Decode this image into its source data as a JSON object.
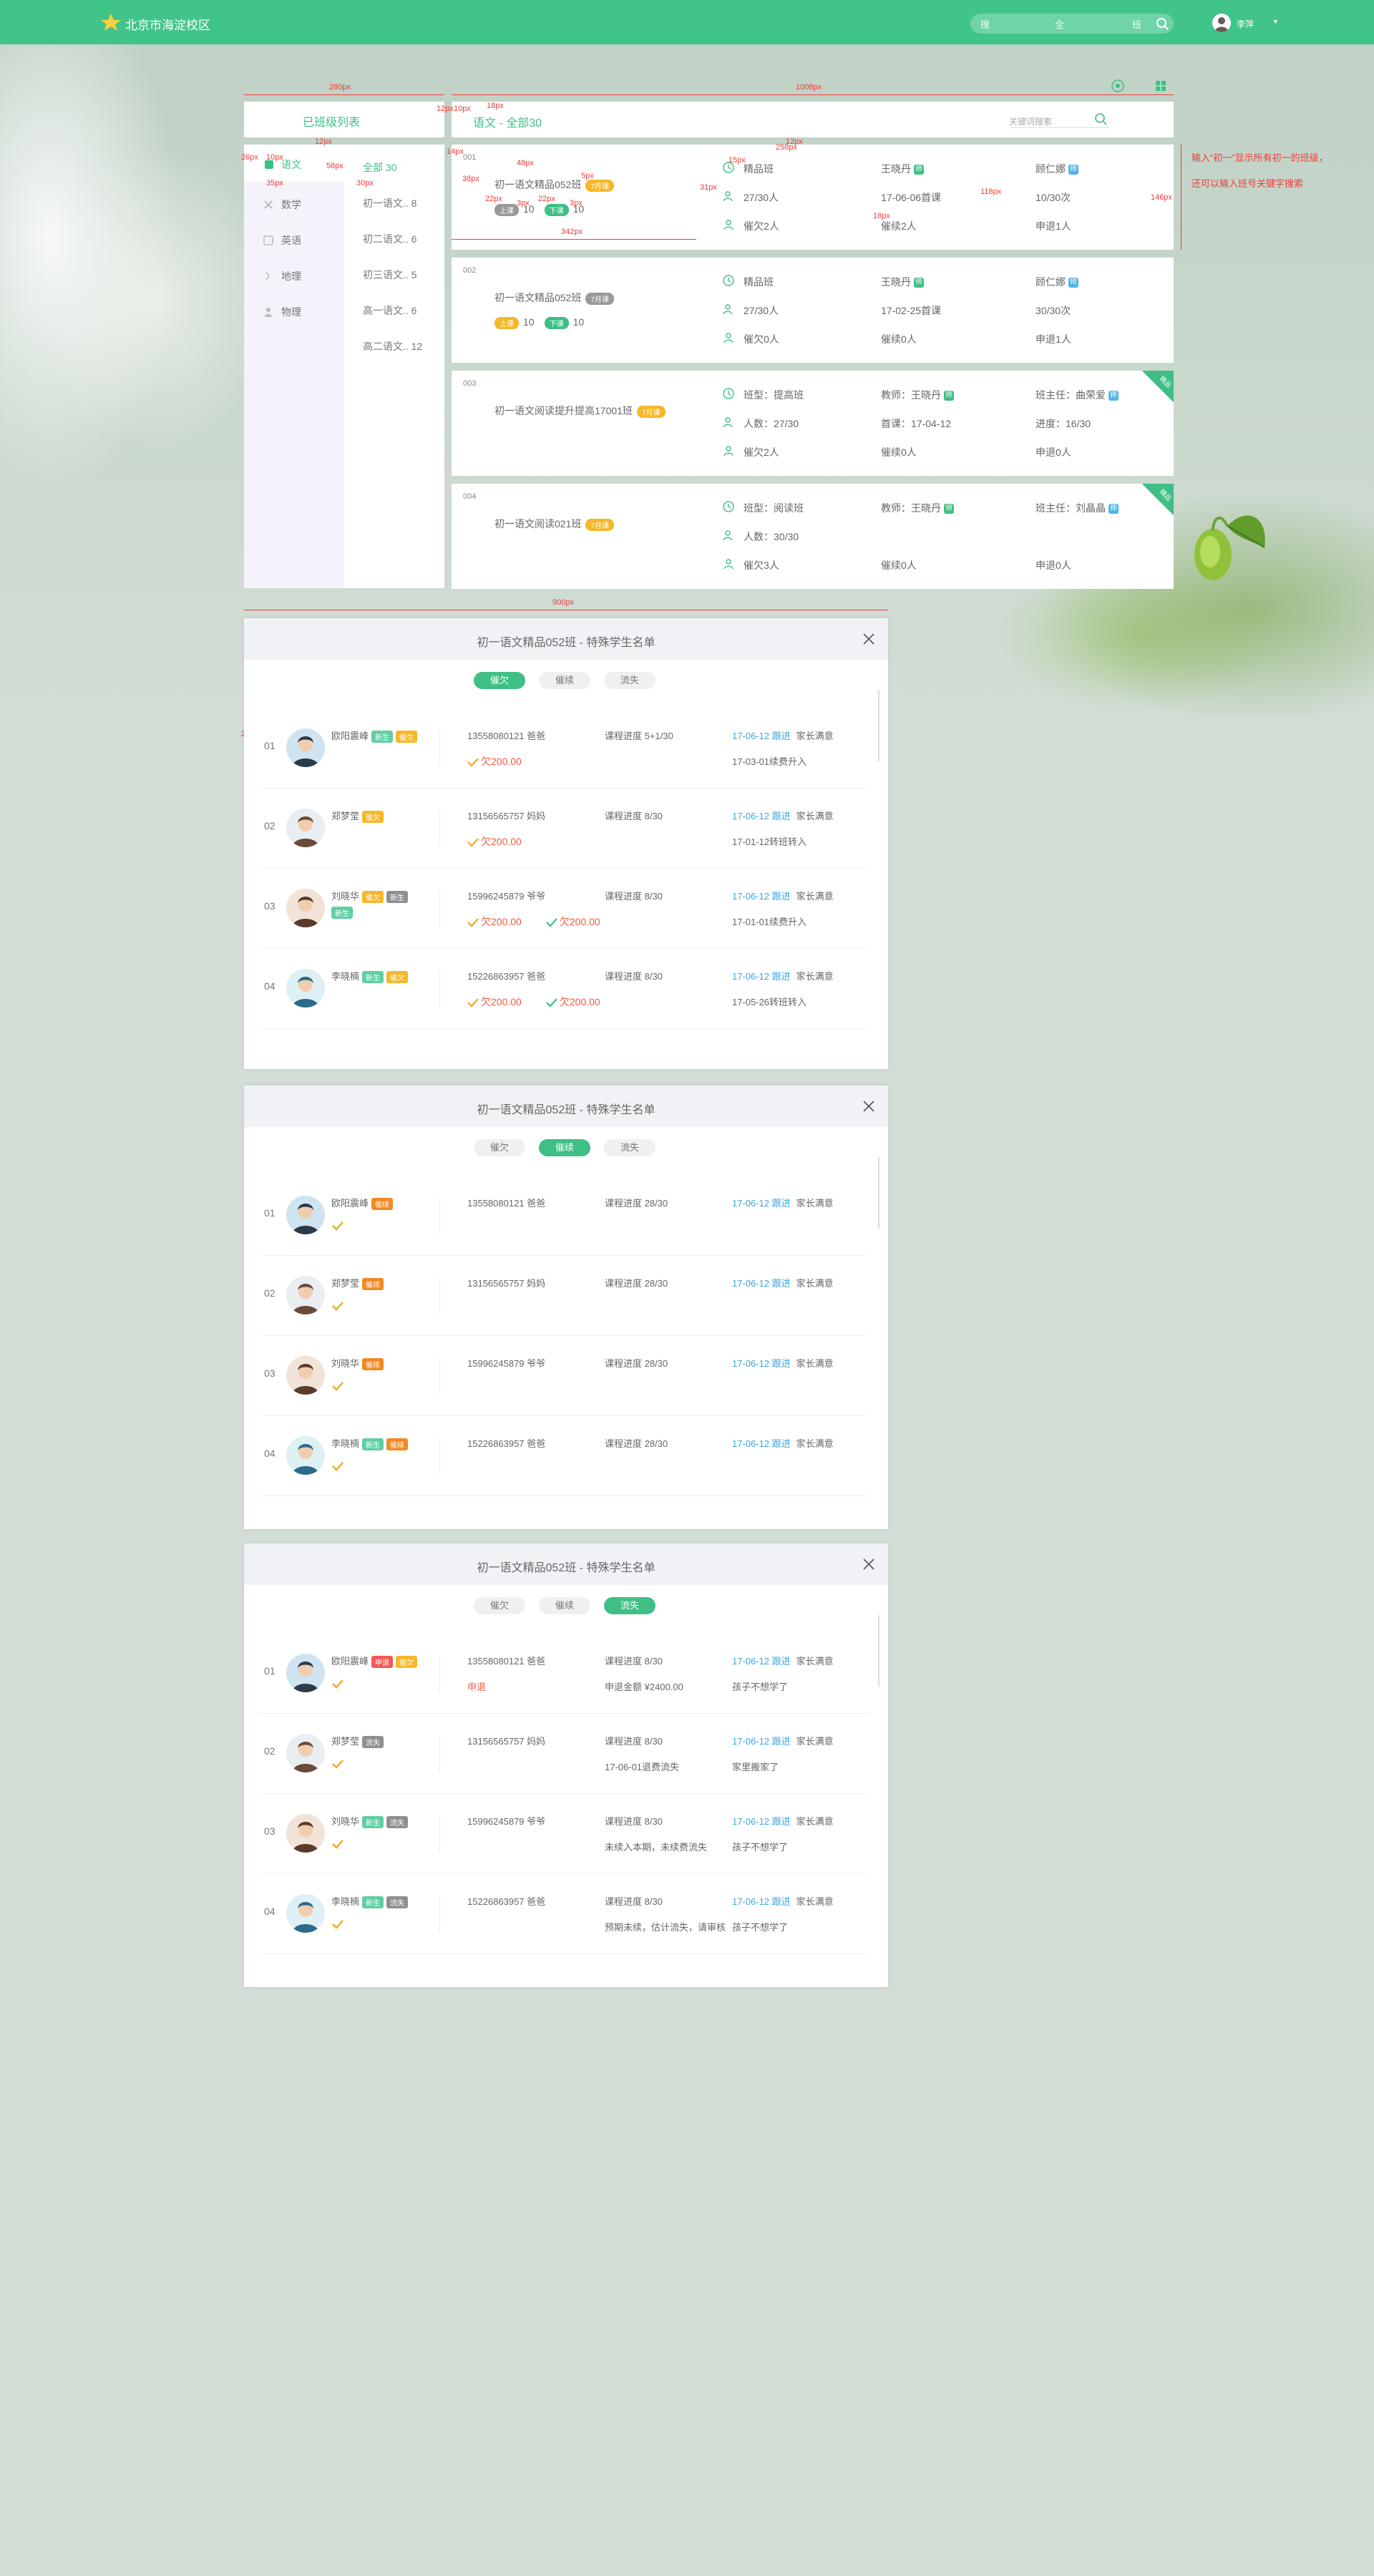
{
  "topbar": {
    "brand": "北京市海淀校区",
    "search": [
      "搜",
      "全",
      "班"
    ],
    "username": "李萍",
    "caret": "▼",
    "colors": {
      "bar": "#41c48a"
    }
  },
  "panel": {
    "left_title": "已班级列表",
    "crumb": "语文 - 全部30",
    "kw_placeholder": "关键词搜索"
  },
  "subjects": [
    {
      "label": "语文",
      "icon": "book-icon"
    },
    {
      "label": "数学",
      "icon": "math-icon"
    },
    {
      "label": "英语",
      "icon": "english-icon"
    },
    {
      "label": "地理",
      "icon": "globe-icon"
    },
    {
      "label": "物理",
      "icon": "atom-icon"
    }
  ],
  "classes": [
    "全部 30",
    "初一语文.. 8",
    "初二语文.. 6",
    "初三语文.. 5",
    "高一语文.. 6",
    "高二语文.. 12"
  ],
  "cards": [
    {
      "num": "001",
      "name": "初一语文精品052班",
      "tag": "7月课",
      "b1": "上课",
      "b1v": "10",
      "b2": "下课",
      "b2v": "10",
      "rows": [
        [
          "精品班",
          "王晓丹",
          "顾仁娜"
        ],
        [
          "27/30人",
          "17-06-06首课",
          "10/30次"
        ],
        [
          "催欠2人",
          "催续2人",
          "申退1人"
        ]
      ]
    },
    {
      "num": "002",
      "name": "初一语文精品052班",
      "tag": "7月课",
      "b1": "上课",
      "b1v": "10",
      "b2": "下课",
      "b2v": "10",
      "rows": [
        [
          "精品班",
          "王晓丹",
          "顾仁娜"
        ],
        [
          "27/30人",
          "17-02-25首课",
          "30/30次"
        ],
        [
          "催欠0人",
          "催续0人",
          "申退1人"
        ]
      ]
    },
    {
      "num": "003",
      "name": "初一语文阅读提升提高17001班",
      "tag": "7月课",
      "corner": "精品",
      "rows": [
        [
          "班型：提高班",
          "教师：王晓丹",
          "班主任：曲荣爱"
        ],
        [
          "人数：27/30",
          "首课：17-04-12",
          "进度：16/30"
        ],
        [
          "催欠2人",
          "催续0人",
          "申退0人"
        ]
      ]
    },
    {
      "num": "004",
      "name": "初一语文阅读021班",
      "tag": "7月课",
      "corner": "精品",
      "rows": [
        [
          "班型：阅读班",
          "教师：王晓丹",
          "班主任：刘晶晶"
        ],
        [
          "人数：30/30",
          "",
          ""
        ],
        [
          "催欠3人",
          "催续0人",
          "申退0人"
        ]
      ]
    }
  ],
  "annotations": {
    "w280": "280px",
    "w1008": "1008px",
    "w12": "12px",
    "w10": "10px",
    "w18": "18px",
    "w12b": "12px",
    "w14": "14px",
    "w48": "48px",
    "w5": "5px",
    "w22": "22px",
    "w3": "3px",
    "w22b": "22px",
    "w3b": "3px",
    "w342": "342px",
    "w15": "15px",
    "w258": "258px",
    "w12c": "12px",
    "w31": "31px",
    "w18b": "18px",
    "w118": "118px",
    "w146": "146px",
    "w26": "26px",
    "w10b": "10px",
    "w35": "35px",
    "w58": "58px",
    "w30": "30px",
    "w38": "38px",
    "w900": "900px",
    "w20": "20px",
    "w26b": "26px",
    "w18c": "18px",
    "w12d": "12px",
    "w11": "11px",
    "w5b": "5px",
    "w72": "72px",
    "w78": "78px",
    "w112": "112px",
    "w23": "23px",
    "w293": "293px",
    "w428": "428px",
    "note1": "输入“初一”显示所有初一的班级，",
    "note2": "还可以输入班号关键字搜索"
  },
  "modals": [
    {
      "title": "初一语文精品052班 - 特殊学生名单",
      "tabs": [
        "催欠",
        "催续",
        "流失"
      ],
      "active": 0,
      "students": [
        {
          "idx": "01",
          "name": "欧阳震峰",
          "tags": [
            [
              "新生",
              "t"
            ],
            [
              "催欠",
              "y"
            ]
          ],
          "phone": "13558080121 爸爸",
          "owe": [
            "欠200.00"
          ],
          "prog": "课程进度 5+1/30",
          "follow": "17-06-12 跟进",
          "follow2": "家长满意",
          "note": "17-03-01续费升入"
        },
        {
          "idx": "02",
          "name": "郑梦莹",
          "tags": [
            [
              "催欠",
              "y"
            ]
          ],
          "phone": "13156565757 妈妈",
          "owe": [
            "欠200.00"
          ],
          "prog": "课程进度 8/30",
          "follow": "17-06-12 跟进",
          "follow2": "家长满意",
          "note": "17-01-12转班转入"
        },
        {
          "idx": "03",
          "name": "刘晓华",
          "tags": [
            [
              "催欠",
              "y"
            ],
            [
              "新生",
              "gy"
            ]
          ],
          "tags2": [
            [
              "新生",
              "t"
            ]
          ],
          "phone": "15996245879 爷爷",
          "owe": [
            "欠200.00",
            "欠200.00"
          ],
          "prog": "课程进度 8/30",
          "follow": "17-06-12 跟进",
          "follow2": "家长满意",
          "note": "17-01-01续费升入"
        },
        {
          "idx": "04",
          "name": "李晓楠",
          "tags": [
            [
              "新生",
              "t"
            ],
            [
              "催欠",
              "y"
            ]
          ],
          "phone": "15226863957 爸爸",
          "owe": [
            "欠200.00",
            "欠200.00"
          ],
          "prog": "课程进度 8/30",
          "follow": "17-06-12 跟进",
          "follow2": "家长满意",
          "note": "17-05-26转班转入"
        }
      ]
    },
    {
      "title": "初一语文精品052班 - 特殊学生名单",
      "tabs": [
        "催欠",
        "催续",
        "流失"
      ],
      "active": 1,
      "students": [
        {
          "idx": "01",
          "name": "欧阳震峰",
          "tags": [
            [
              "催续",
              "o"
            ]
          ],
          "phone": "13558080121 爸爸",
          "prog": "课程进度 28/30",
          "follow": "17-06-12 跟进",
          "follow2": "家长满意"
        },
        {
          "idx": "02",
          "name": "郑梦莹",
          "tags": [
            [
              "催续",
              "o"
            ]
          ],
          "phone": "13156565757 妈妈",
          "prog": "课程进度 28/30",
          "follow": "17-06-12 跟进",
          "follow2": "家长满意"
        },
        {
          "idx": "03",
          "name": "刘晓华",
          "tags": [
            [
              "催续",
              "o"
            ]
          ],
          "phone": "15996245879 爷爷",
          "prog": "课程进度 28/30",
          "follow": "17-06-12 跟进",
          "follow2": "家长满意"
        },
        {
          "idx": "04",
          "name": "李晓楠",
          "tags": [
            [
              "新生",
              "t"
            ],
            [
              "催续",
              "o"
            ]
          ],
          "phone": "15226863957 爸爸",
          "prog": "课程进度 28/30",
          "follow": "17-06-12 跟进",
          "follow2": "家长满意"
        }
      ]
    },
    {
      "title": "初一语文精品052班 - 特殊学生名单",
      "tabs": [
        "催欠",
        "催续",
        "流失"
      ],
      "active": 2,
      "students": [
        {
          "idx": "01",
          "name": "欧阳震峰",
          "tags": [
            [
              "申退",
              "r"
            ],
            [
              "催欠",
              "y"
            ]
          ],
          "phone": "13558080121 爸爸",
          "red": "申退",
          "prog": "课程进度 8/30",
          "sub": "申退金额 ¥2400.00",
          "follow": "17-06-12 跟进",
          "follow2": "家长满意",
          "note": "孩子不想学了"
        },
        {
          "idx": "02",
          "name": "郑梦莹",
          "tags": [
            [
              "流失",
              "gy"
            ]
          ],
          "phone": "13156565757 妈妈",
          "prog": "课程进度 8/30",
          "sub": "17-06-01退费流失",
          "follow": "17-06-12 跟进",
          "follow2": "家长满意",
          "note": "家里搬家了"
        },
        {
          "idx": "03",
          "name": "刘晓华",
          "tags": [
            [
              "新生",
              "t"
            ],
            [
              "流失",
              "gy"
            ]
          ],
          "phone": "15996245879 爷爷",
          "prog": "课程进度 8/30",
          "sub": "未续入本期，未续费流失",
          "follow": "17-06-12 跟进",
          "follow2": "家长满意",
          "note": "孩子不想学了"
        },
        {
          "idx": "04",
          "name": "李晓楠",
          "tags": [
            [
              "新生",
              "t"
            ],
            [
              "流失",
              "gy"
            ]
          ],
          "phone": "15226863957 爸爸",
          "prog": "课程进度 8/30",
          "sub": "预期未续，估计流失，请审核",
          "follow": "17-06-12 跟进",
          "follow2": "家长满意",
          "note": "孩子不想学了"
        }
      ]
    }
  ]
}
